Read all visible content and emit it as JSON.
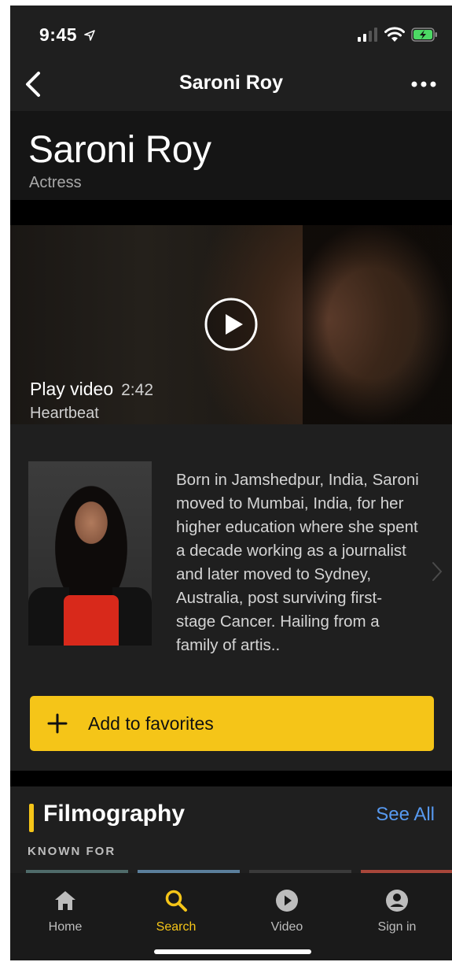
{
  "status_bar": {
    "time": "9:45",
    "location_arrow": "location-arrow-icon",
    "battery_color": "#4cd964"
  },
  "nav": {
    "title": "Saroni Roy",
    "back_icon": "chevron-left-icon",
    "more_icon": "more-horizontal-icon"
  },
  "header": {
    "name": "Saroni Roy",
    "role": "Actress"
  },
  "video": {
    "label": "Play video",
    "duration": "2:42",
    "subtitle": "Heartbeat"
  },
  "bio": {
    "text": "Born in Jamshedpur, India, Saroni moved to Mumbai, India, for her higher education where she spent a decade working as a journalist and later moved to Sydney, Australia, post surviving first-stage Cancer. Hailing from a family of artis.."
  },
  "favorites": {
    "label": "Add to favorites",
    "color": "#f5c518"
  },
  "filmography": {
    "title": "Filmography",
    "see_all": "See All",
    "known_for": "KNOWN FOR"
  },
  "tabs": [
    {
      "label": "Home",
      "icon": "home-icon",
      "active": false
    },
    {
      "label": "Search",
      "icon": "search-icon",
      "active": true
    },
    {
      "label": "Video",
      "icon": "play-circle-icon",
      "active": false
    },
    {
      "label": "Sign in",
      "icon": "user-circle-icon",
      "active": false
    }
  ],
  "colors": {
    "accent": "#f5c518",
    "link": "#5799ef",
    "background": "#1f1f1f"
  }
}
